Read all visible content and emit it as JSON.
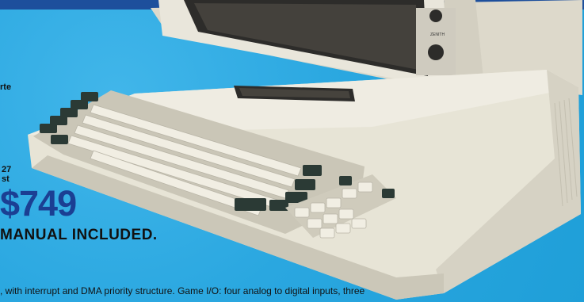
{
  "fragments": {
    "rte": "rte",
    "n27": "27",
    "st": "st"
  },
  "price": "$749",
  "manual_text": "MANUAL INCLUDED.",
  "bottom_text": ", with interrupt and DMA priority structure. Game I/O: four analog to digital inputs, three",
  "colors": {
    "background": "#1f9fd8",
    "top_band": "#1d4f9c",
    "price": "#1b3f93",
    "case": "#e7e4d6",
    "keycap_light": "#f1eee3",
    "keycap_dark": "#2b3a35"
  },
  "illustration": {
    "subject": "computer-with-keyboard-and-monitor",
    "keypad": "numeric-keypad"
  }
}
